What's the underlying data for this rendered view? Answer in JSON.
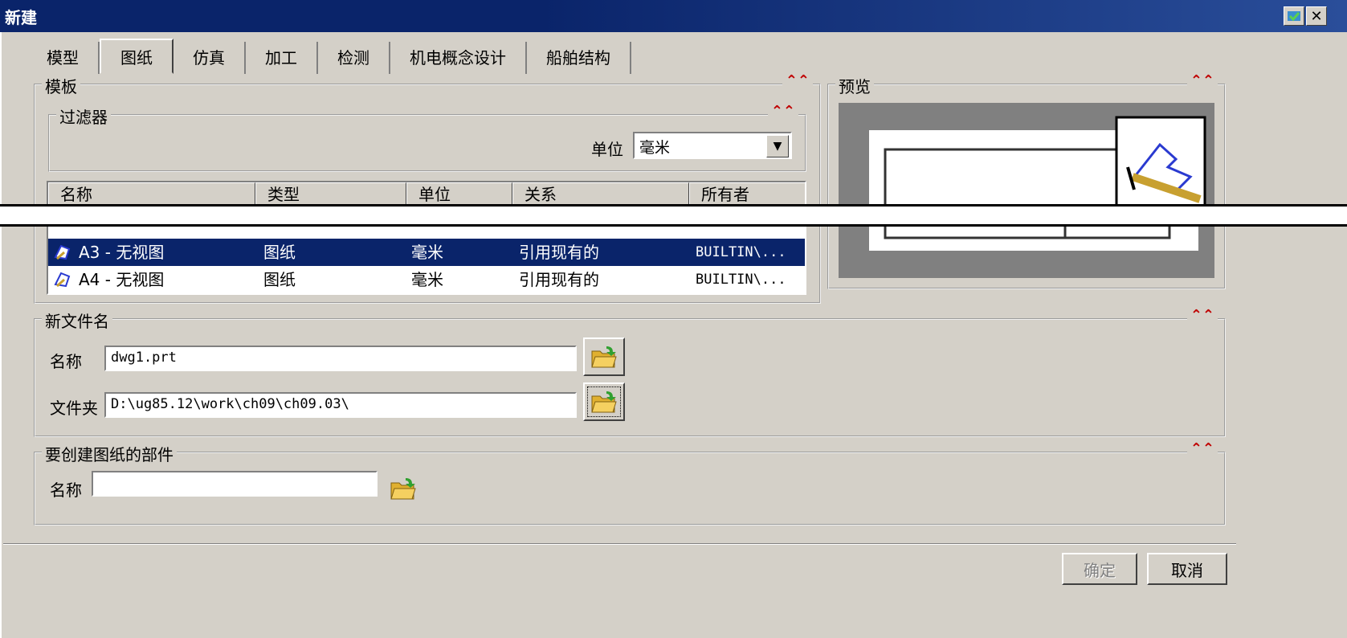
{
  "window": {
    "title": "新建"
  },
  "tabs": [
    {
      "label": "模型"
    },
    {
      "label": "图纸"
    },
    {
      "label": "仿真"
    },
    {
      "label": "加工"
    },
    {
      "label": "检测"
    },
    {
      "label": "机电概念设计"
    },
    {
      "label": "船舶结构"
    }
  ],
  "active_tab": "图纸",
  "template": {
    "title": "模板",
    "filter": {
      "title": "过滤器",
      "unit_label": "单位",
      "unit_value": "毫米"
    },
    "columns": [
      "名称",
      "类型",
      "单位",
      "关系",
      "所有者"
    ],
    "rows": [
      {
        "name": "A3 - 无视图",
        "type": "图纸",
        "unit": "毫米",
        "relation": "引用现有的",
        "owner": "BUILTIN\\...",
        "selected": true
      },
      {
        "name": "A4 - 无视图",
        "type": "图纸",
        "unit": "毫米",
        "relation": "引用现有的",
        "owner": "BUILTIN\\...",
        "selected": false
      }
    ]
  },
  "preview": {
    "title": "预览"
  },
  "new_file": {
    "title": "新文件名",
    "name_label": "名称",
    "name_value": "dwg1.prt",
    "folder_label": "文件夹",
    "folder_value": "D:\\ug85.12\\work\\ch09\\ch09.03\\"
  },
  "part": {
    "title": "要创建图纸的部件",
    "name_label": "名称",
    "name_value": ""
  },
  "buttons": {
    "ok": "确定",
    "cancel": "取消"
  },
  "colors": {
    "title_bar": "#0a246a",
    "selection": "#0a246a",
    "collapse_arrows": "#c00000",
    "dialog_bg": "#d4d0c8"
  }
}
